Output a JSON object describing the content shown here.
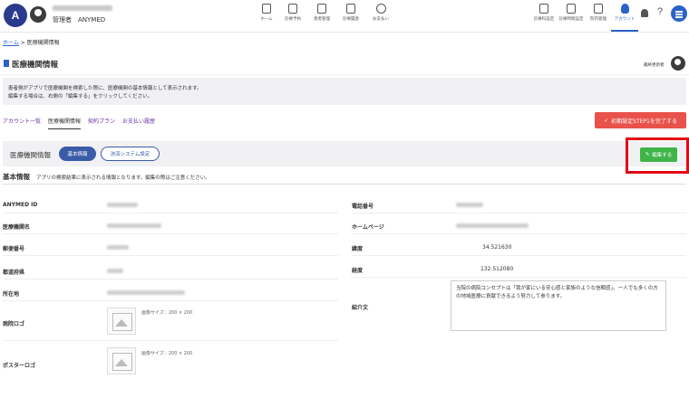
{
  "header": {
    "logo_letter": "A",
    "admin_name": "管理者　ANYMED",
    "nav": [
      {
        "label": "ホーム",
        "icon": "home-icon"
      },
      {
        "label": "診療予約",
        "icon": "calendar-icon"
      },
      {
        "label": "患者管理",
        "icon": "patient-icon"
      },
      {
        "label": "診療履歴",
        "icon": "history-icon"
      },
      {
        "label": "お支払い",
        "icon": "payment-icon"
      }
    ],
    "right_nav": [
      {
        "label": "診療科設定",
        "icon": "department-icon"
      },
      {
        "label": "診療時間設定",
        "icon": "clock-icon"
      },
      {
        "label": "院内管理",
        "icon": "folder-icon"
      },
      {
        "label": "アカウント",
        "icon": "account-icon"
      }
    ],
    "help": "?"
  },
  "breadcrumb": {
    "home": "ホーム",
    "separator": " > ",
    "current": "医療機関情報"
  },
  "page": {
    "title": "医療機関情報",
    "last_updated": "最終更新者",
    "info_line1": "患者側がアプリで医療機関を検索した際に、医療機関の基本情報として表示されます。",
    "info_line2": "編集する場合は、右側の「編集する」をクリックしてください。"
  },
  "tabs": [
    "アカウント一覧",
    "医療機関情報",
    "契約プラン",
    "お支払い履歴"
  ],
  "complete_button": "初期設定STEP1を完了する",
  "section": {
    "title": "医療機関情報",
    "basic_button": "基本情報",
    "payment_button": "決済システム設定",
    "edit_button": "編集する"
  },
  "basic": {
    "heading": "基本情報",
    "note": "アプリの検索結果に表示される情報となります。編集の際はご注意ください。"
  },
  "fields_left": {
    "anymed_id": "ANYMED ID",
    "clinic_name": "医療機関名",
    "postal_code": "郵便番号",
    "prefecture": "都道府県",
    "address": "所在地",
    "hospital_logo": "病院ロゴ",
    "poster_logo": "ポスターロゴ",
    "image_size": "画像サイズ：200 × 200"
  },
  "fields_right": {
    "phone": "電話番号",
    "homepage": "ホームページ",
    "latitude_label": "緯度",
    "latitude_value": "34.521630",
    "longitude_label": "経度",
    "longitude_value": "132.512080",
    "intro_label": "紹介文",
    "intro_text": "当院の病院コンセプトは「我が家にいる安心感と家族のような信頼感」。一人でも多くの方の地域医療に貢献できるよう努力して参ります。"
  },
  "colors": {
    "primary_blue": "#2a62c8",
    "complete_red": "#e8524a",
    "edit_green": "#3fb549",
    "highlight_red": "#e30613",
    "tab_purple": "#6b39a8"
  }
}
